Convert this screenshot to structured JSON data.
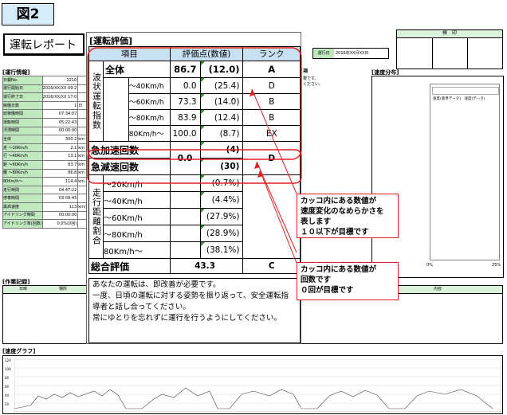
{
  "figure_label": "図2",
  "report_title": "運転レポート",
  "header": {
    "datetime_label": "運行日",
    "datetime_value": "2016年XX月XX日",
    "stamp_label": "検　印"
  },
  "ops_info": {
    "title": "[運行情報]",
    "rows": [
      {
        "label": "日報No.",
        "value": "2210",
        "unit": ""
      },
      {
        "label": "運行開始日",
        "value": "2016/XX/XX 09:2",
        "unit": ""
      },
      {
        "label": "運行終了日",
        "value": "2016/XX/XX 17:0",
        "unit": ""
      },
      {
        "label": "稼働日数",
        "value": "1",
        "unit": "日"
      },
      {
        "label": "総稼働時間",
        "value": "07:34:07",
        "unit": ""
      },
      {
        "label": "運転時間",
        "value": "05:22:43",
        "unit": ""
      },
      {
        "label": "渋滞時間",
        "value": "00:00:00",
        "unit": ""
      },
      {
        "label": "全体",
        "value": "300.2",
        "unit": "km"
      },
      {
        "label": "走 ～20Km/h",
        "value": "2.1",
        "unit": "km"
      },
      {
        "label": "行 ～40Km/h",
        "value": "13.1",
        "unit": "km"
      },
      {
        "label": "距 ～60Km/h",
        "value": "83.7",
        "unit": "km"
      },
      {
        "label": "離 ～80Km/h",
        "value": "86.8",
        "unit": "km"
      },
      {
        "label": "80Km/h～",
        "value": "114.4",
        "unit": "km"
      },
      {
        "label": "走行時間",
        "value": "04:47:22",
        "unit": ""
      },
      {
        "label": "停車時間",
        "value": "03:09:45",
        "unit": ""
      },
      {
        "label": "最高速度",
        "value": "113",
        "unit": "km/h"
      },
      {
        "label": "アイドリング時間",
        "value": "00:00:00",
        "unit": ""
      },
      {
        "label": "アイドリング率(回数)",
        "value": "0.0%(0回)",
        "unit": ""
      }
    ]
  },
  "speed_dist": {
    "title": "[速度分布]",
    "legend": "速度(基準データ)　速度(データ)",
    "x_min": "0%",
    "x_max": "25%"
  },
  "work_log": {
    "title": "[作業記録]",
    "col_date": "日時",
    "col_place": "場所",
    "col_content": "内容"
  },
  "speed_graph": {
    "title": "[速度グラフ]",
    "y_ticks": [
      "120",
      "100",
      "80",
      "60",
      "40",
      "20"
    ]
  },
  "partial_texts": {
    "advice_title": "項",
    "advice_line1": "要です。",
    "advice_line2": "ください。"
  },
  "eval": {
    "title": "[運転評価]",
    "headers": {
      "item": "項目",
      "score": "評価点(数値)",
      "rank": "ランク"
    },
    "wave_label": "波状運転指数",
    "rows": [
      {
        "label": "全体",
        "score": "86.7",
        "value": "(12.0)",
        "rank": "A"
      },
      {
        "label": "～40Km/h",
        "score": "0.0",
        "value": "(25.4)",
        "rank": "D"
      },
      {
        "label": "～60Km/h",
        "score": "73.3",
        "value": "(14.0)",
        "rank": "B"
      },
      {
        "label": "～80Km/h",
        "score": "83.9",
        "value": "(12.4)",
        "rank": "B"
      },
      {
        "label": "80Km/h～",
        "score": "100.0",
        "value": "(8.7)",
        "rank": "EX"
      }
    ],
    "accel": {
      "label": "急加速回数",
      "value": "(4)"
    },
    "decel": {
      "label": "急減速回数",
      "value": "(30)"
    },
    "accel_score": "0.0",
    "accel_rank": "D",
    "dist_label": "走行距離割合",
    "dist_rows": [
      {
        "label": "～20Km/h",
        "value": "(0.7%)"
      },
      {
        "label": "～40Km/h",
        "value": "(4.4%)"
      },
      {
        "label": "～60Km/h",
        "value": "(27.9%)"
      },
      {
        "label": "～80Km/h",
        "value": "(28.9%)"
      },
      {
        "label": "80Km/h～",
        "value": "(38.1%)"
      }
    ],
    "total": {
      "label": "総合評価",
      "score": "43.3",
      "rank": "C"
    },
    "message": "あなたの運転は、即改善が必要です。\n一度、日頃の運転に対する姿勢を振り返って、安全運転指\n導者と話し合ってください。\n常にゆとりを忘れずに運行を行うようにしてください。"
  },
  "callouts": {
    "smoothness": "カッコ内にある数値が\n速度変化のなめらかさを\n表します\n１０以下が目標です",
    "count": "カッコ内にある数値が\n回数です\n０回が目標です"
  },
  "colors": {
    "accent_red": "#e02020",
    "header_blue": "#c7e0f2",
    "label_green": "#bfe8bf"
  }
}
